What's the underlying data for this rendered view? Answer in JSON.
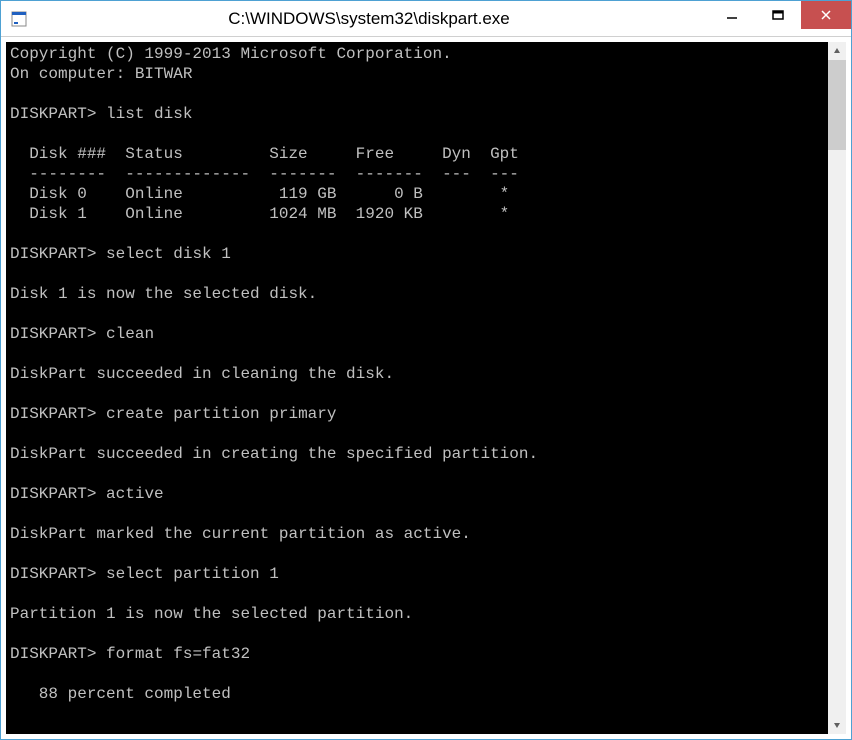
{
  "window": {
    "title": "C:\\WINDOWS\\system32\\diskpart.exe"
  },
  "terminal": {
    "copyright": "Copyright (C) 1999-2013 Microsoft Corporation.",
    "computer_line": "On computer: BITWAR",
    "prompt": "DISKPART>",
    "cmd_list_disk": "list disk",
    "table_header_line": "  Disk ###  Status         Size     Free     Dyn  Gpt",
    "table_divider_line": "  --------  -------------  -------  -------  ---  ---",
    "disk_row_0": "  Disk 0    Online          119 GB      0 B        *",
    "disk_row_1": "  Disk 1    Online         1024 MB  1920 KB        *",
    "cmd_select_disk": "select disk 1",
    "msg_disk_selected": "Disk 1 is now the selected disk.",
    "cmd_clean": "clean",
    "msg_clean_success": "DiskPart succeeded in cleaning the disk.",
    "cmd_create_partition": "create partition primary",
    "msg_create_success": "DiskPart succeeded in creating the specified partition.",
    "cmd_active": "active",
    "msg_active_success": "DiskPart marked the current partition as active.",
    "cmd_select_partition": "select partition 1",
    "msg_partition_selected": "Partition 1 is now the selected partition.",
    "cmd_format": "format fs=fat32",
    "msg_progress": "   88 percent completed"
  }
}
